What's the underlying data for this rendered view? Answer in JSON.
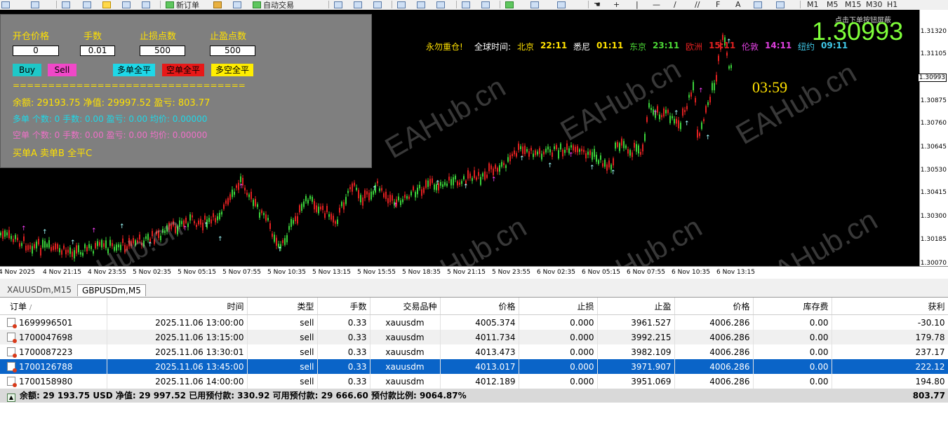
{
  "toolbar": {
    "new_order": "新订单",
    "auto_trading": "自动交易",
    "timeframes": [
      "M1",
      "M5",
      "M15",
      "M30",
      "H1"
    ]
  },
  "panel": {
    "labels": {
      "open_price": "开仓价格",
      "lots": "手数",
      "sl_points": "止损点数",
      "tp_points": "止盈点数"
    },
    "values": {
      "open_price": "0",
      "lots": "0.01",
      "sl_points": "500",
      "tp_points": "500"
    },
    "buttons": {
      "buy": "Buy",
      "sell": "Sell",
      "close_long": "多单全平",
      "close_short": "空单全平",
      "close_all": "多空全平"
    },
    "separator": "=================================",
    "account": "余额: 29193.75  净值: 29997.52  盈亏: 803.77",
    "long_summary": "多单  个数: 0  手数: 0.00  盈亏: 0.00  均价: 0.00000",
    "short_summary": "空单  个数: 0  手数: 0.00  盈亏: 0.00  均价: 0.00000",
    "hotkeys": "买单A  卖单B  全平C"
  },
  "overlay": {
    "motto": "永勿重仓!",
    "world_time_label": "全球时间:",
    "cities": [
      {
        "name": "北京",
        "time": "22:11",
        "name_color": "#ffe100",
        "time_color": "#ffe100"
      },
      {
        "name": "悉尼",
        "time": "01:11",
        "name_color": "#ffffff",
        "time_color": "#ffe100"
      },
      {
        "name": "东京",
        "time": "23:11",
        "name_color": "#4cd936",
        "time_color": "#4cd936"
      },
      {
        "name": "欧洲",
        "time": "15:11",
        "name_color": "#e02020",
        "time_color": "#e02020"
      },
      {
        "name": "伦敦",
        "time": "14:11",
        "name_color": "#e040e0",
        "time_color": "#e040e0"
      },
      {
        "name": "纽约",
        "time": "09:11",
        "name_color": "#40c8e8",
        "time_color": "#40c8e8"
      }
    ],
    "big_price": "1.30993",
    "countdown": "03:59",
    "top_note": "点击下单按钮屏蔽",
    "watermark": "EAHub.cn"
  },
  "price_axis": [
    "1.31320",
    "1.31105",
    "1.30993",
    "1.30875",
    "1.30760",
    "1.30645",
    "1.30530",
    "1.30415",
    "1.30300",
    "1.30185",
    "1.30070"
  ],
  "time_axis": [
    "4 Nov 2025",
    "4 Nov 21:15",
    "4 Nov 23:55",
    "5 Nov 02:35",
    "5 Nov 05:15",
    "5 Nov 07:55",
    "5 Nov 10:35",
    "5 Nov 13:15",
    "5 Nov 15:55",
    "5 Nov 18:35",
    "5 Nov 21:15",
    "5 Nov 23:55",
    "6 Nov 02:35",
    "6 Nov 05:15",
    "6 Nov 07:55",
    "6 Nov 10:35",
    "6 Nov 13:15"
  ],
  "chart_tabs": [
    {
      "label": "XAUUSDm,M15",
      "active": false
    },
    {
      "label": "GBPUSDm,M5",
      "active": true
    }
  ],
  "orders": {
    "columns": [
      "订单",
      "时间",
      "类型",
      "手数",
      "交易品种",
      "价格",
      "止损",
      "止盈",
      "价格",
      "库存费",
      "获利"
    ],
    "rows": [
      {
        "ticket": "1699996501",
        "time": "2025.11.06 13:00:00",
        "type": "sell",
        "lots": "0.33",
        "symbol": "xauusdm",
        "open": "4005.374",
        "sl": "0.000",
        "tp": "3961.527",
        "price": "4006.286",
        "swap": "0.00",
        "profit": "-30.10"
      },
      {
        "ticket": "1700047698",
        "time": "2025.11.06 13:15:00",
        "type": "sell",
        "lots": "0.33",
        "symbol": "xauusdm",
        "open": "4011.734",
        "sl": "0.000",
        "tp": "3992.215",
        "price": "4006.286",
        "swap": "0.00",
        "profit": "179.78"
      },
      {
        "ticket": "1700087223",
        "time": "2025.11.06 13:30:01",
        "type": "sell",
        "lots": "0.33",
        "symbol": "xauusdm",
        "open": "4013.473",
        "sl": "0.000",
        "tp": "3982.109",
        "price": "4006.286",
        "swap": "0.00",
        "profit": "237.17"
      },
      {
        "ticket": "1700126788",
        "time": "2025.11.06 13:45:00",
        "type": "sell",
        "lots": "0.33",
        "symbol": "xauusdm",
        "open": "4013.017",
        "sl": "0.000",
        "tp": "3971.907",
        "price": "4006.286",
        "swap": "0.00",
        "profit": "222.12"
      },
      {
        "ticket": "1700158980",
        "time": "2025.11.06 14:00:00",
        "type": "sell",
        "lots": "0.33",
        "symbol": "xauusdm",
        "open": "4012.189",
        "sl": "0.000",
        "tp": "3951.069",
        "price": "4006.286",
        "swap": "0.00",
        "profit": "194.80"
      }
    ],
    "selected_index": 3,
    "summary_text": "余额: 29 193.75 USD  净值: 29 997.52  已用预付款: 330.92  可用预付款: 29 666.60  预付款比例: 9064.87%",
    "summary_profit": "803.77"
  }
}
